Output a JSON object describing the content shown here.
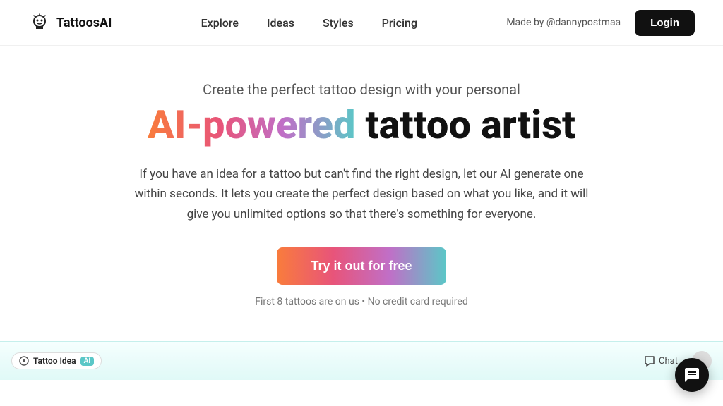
{
  "navbar": {
    "logo_text": "TattoosAI",
    "nav_links": [
      {
        "label": "Explore",
        "href": "#"
      },
      {
        "label": "Ideas",
        "href": "#"
      },
      {
        "label": "Styles",
        "href": "#"
      },
      {
        "label": "Pricing",
        "href": "#"
      }
    ],
    "made_by": "Made by @dannypostmaa",
    "login_label": "Login"
  },
  "hero": {
    "subtitle": "Create the perfect tattoo design with your personal",
    "title_gradient": "AI-powered",
    "title_normal": " tattoo artist",
    "description": "If you have an idea for a tattoo but can't find the right design, let our AI generate one within seconds. It lets you create the perfect design based on what you like, and it will give you unlimited options so that there's something for everyone.",
    "cta_label": "Try it out for free",
    "fine_print": "First 8 tattoos are on us • No credit card required"
  },
  "preview": {
    "badge_label": "Tattoo Idea",
    "badge_ai": "AI",
    "chat_label": "Chat"
  },
  "icons": {
    "chat_icon": "💬",
    "logo_icon": "🤖"
  }
}
